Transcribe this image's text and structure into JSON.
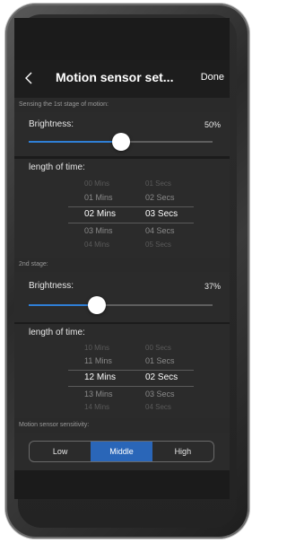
{
  "header": {
    "title": "Motion sensor set...",
    "done_label": "Done"
  },
  "stage1": {
    "section_label": "Sensing the 1st stage of motion:",
    "brightness_label": "Brightness:",
    "brightness_value": "50%",
    "brightness_fraction": 0.5,
    "length_label": "length of time:",
    "picker_rows": [
      {
        "mins": "00 Mins",
        "secs": "01 Secs"
      },
      {
        "mins": "01 Mins",
        "secs": "02 Secs"
      },
      {
        "mins": "02 Mins",
        "secs": "03 Secs"
      },
      {
        "mins": "03 Mins",
        "secs": "04 Secs"
      },
      {
        "mins": "04 Mins",
        "secs": "05 Secs"
      }
    ]
  },
  "stage2": {
    "section_label": "2nd stage:",
    "brightness_label": "Brightness:",
    "brightness_value": "37%",
    "brightness_fraction": 0.37,
    "length_label": "length of time:",
    "picker_rows": [
      {
        "mins": "10 Mins",
        "secs": "00 Secs"
      },
      {
        "mins": "11 Mins",
        "secs": "01 Secs"
      },
      {
        "mins": "12 Mins",
        "secs": "02 Secs"
      },
      {
        "mins": "13 Mins",
        "secs": "03 Secs"
      },
      {
        "mins": "14 Mins",
        "secs": "04 Secs"
      }
    ]
  },
  "sensitivity": {
    "section_label": "Motion sensor sensitivity:",
    "options": [
      "Low",
      "Middle",
      "High"
    ],
    "selected": "Middle"
  },
  "colors": {
    "accent": "#2f7fd6",
    "selected_segment": "#2a66b8",
    "background": "#1b1b1b"
  }
}
